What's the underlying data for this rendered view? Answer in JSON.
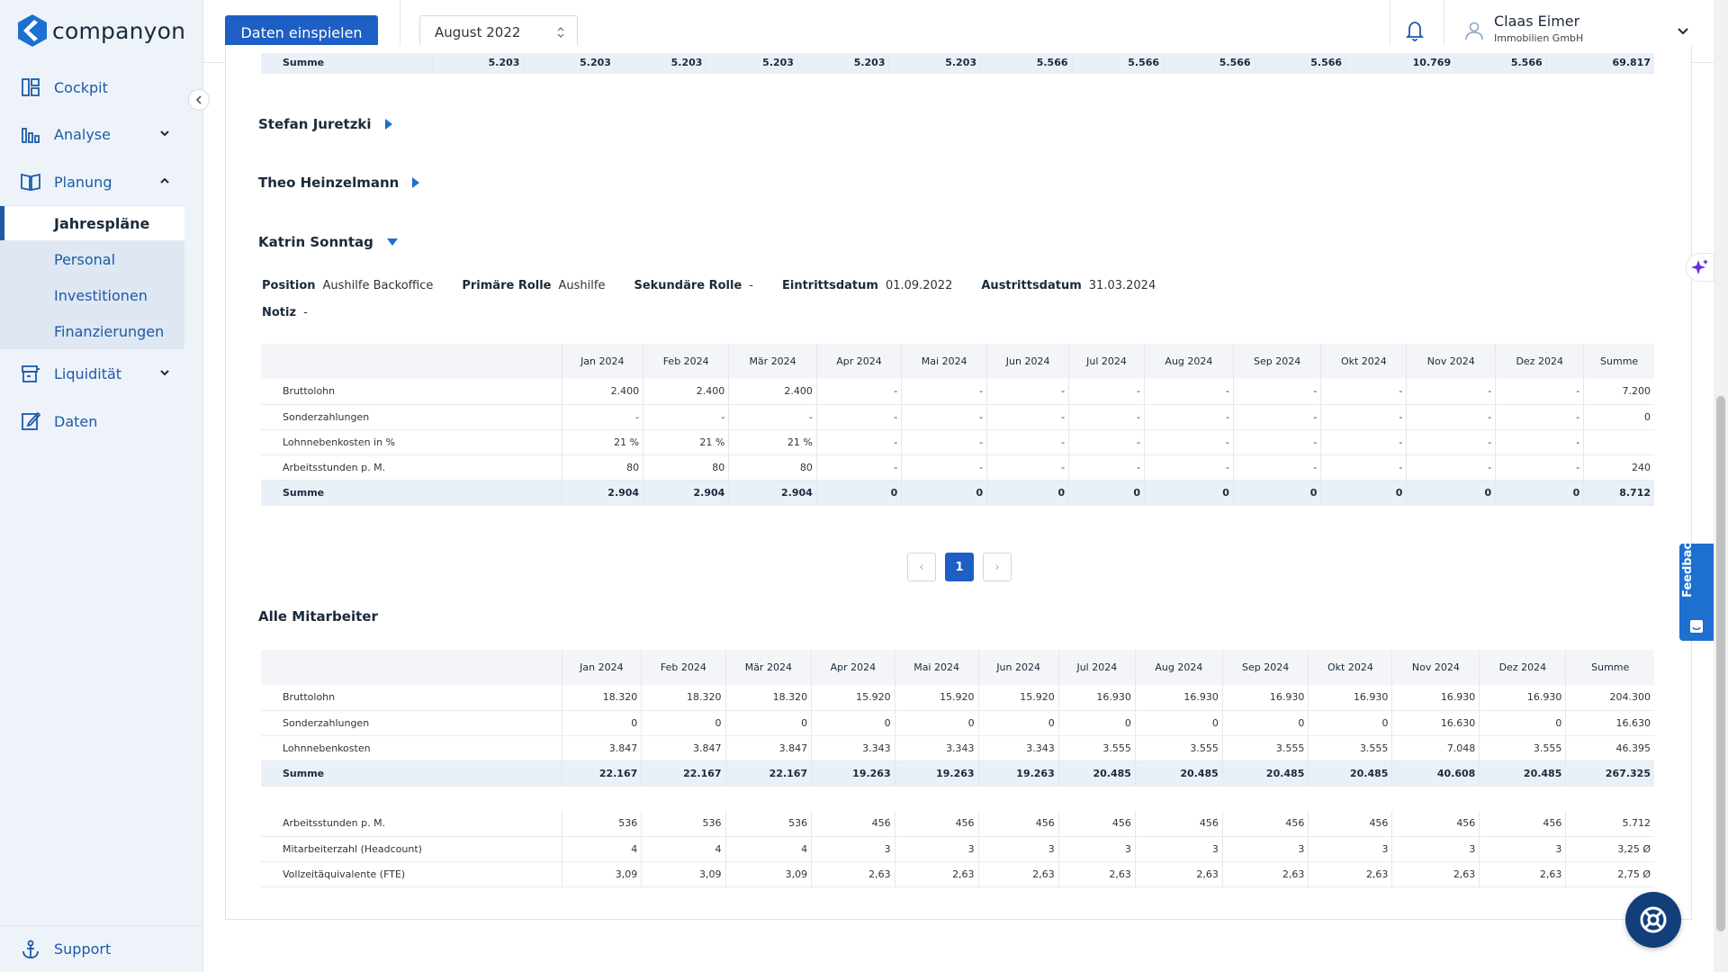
{
  "app": {
    "brand": "companyon"
  },
  "sidebar": {
    "items": [
      {
        "label": "Cockpit",
        "icon": "dashboard-icon"
      },
      {
        "label": "Analyse",
        "icon": "bar-chart-icon"
      },
      {
        "label": "Planung",
        "icon": "book-icon"
      },
      {
        "label": "Liquidität",
        "icon": "cash-register-icon"
      },
      {
        "label": "Daten",
        "icon": "edit-icon"
      }
    ],
    "planung_sub": [
      {
        "label": "Jahrespläne",
        "active": true
      },
      {
        "label": "Personal"
      },
      {
        "label": "Investitionen"
      },
      {
        "label": "Finanzierungen"
      }
    ],
    "support": "Support"
  },
  "topbar": {
    "primary_button": "Daten einspielen",
    "period": "August 2022",
    "user": {
      "name": "Claas Eimer",
      "company": "Immobilien GmbH"
    }
  },
  "colors": {
    "accent": "#1d5fc4",
    "sum_row": "#eaf0f8",
    "feedback": "#1d6fd0"
  },
  "prev_summary": {
    "label": "Summe",
    "values": [
      "5.203",
      "5.203",
      "5.203",
      "5.203",
      "5.203",
      "5.203",
      "5.566",
      "5.566",
      "5.566",
      "5.566",
      "10.769",
      "5.566",
      "69.817"
    ]
  },
  "employees": [
    {
      "name": "Stefan Juretzki",
      "expanded": false
    },
    {
      "name": "Theo Heinzelmann",
      "expanded": false
    },
    {
      "name": "Katrin Sonntag",
      "expanded": true
    }
  ],
  "katrin": {
    "info": {
      "position_label": "Position",
      "position": "Aushilfe Backoffice",
      "primary_label": "Primäre Rolle",
      "primary": "Aushilfe",
      "secondary_label": "Sekundäre Rolle",
      "secondary": "-",
      "entry_label": "Eintrittsdatum",
      "entry": "01.09.2022",
      "exit_label": "Austrittsdatum",
      "exit": "31.03.2024",
      "note_label": "Notiz",
      "note": "-"
    },
    "columns": [
      "",
      "Jan 2024",
      "Feb 2024",
      "Mär 2024",
      "Apr 2024",
      "Mai 2024",
      "Jun 2024",
      "Jul 2024",
      "Aug 2024",
      "Sep 2024",
      "Okt 2024",
      "Nov 2024",
      "Dez 2024",
      "Summe"
    ],
    "rows": [
      [
        "Bruttolohn",
        "2.400",
        "2.400",
        "2.400",
        "-",
        "-",
        "-",
        "-",
        "-",
        "-",
        "-",
        "-",
        "-",
        "7.200"
      ],
      [
        "Sonderzahlungen",
        "-",
        "-",
        "-",
        "-",
        "-",
        "-",
        "-",
        "-",
        "-",
        "-",
        "-",
        "-",
        "0"
      ],
      [
        "Lohnnebenkosten in %",
        "21 %",
        "21 %",
        "21 %",
        "-",
        "-",
        "-",
        "-",
        "-",
        "-",
        "-",
        "-",
        "-",
        ""
      ],
      [
        "Arbeitsstunden p. M.",
        "80",
        "80",
        "80",
        "-",
        "-",
        "-",
        "-",
        "-",
        "-",
        "-",
        "-",
        "-",
        "240"
      ]
    ],
    "sum_row": [
      "Summe",
      "2.904",
      "2.904",
      "2.904",
      "0",
      "0",
      "0",
      "0",
      "0",
      "0",
      "0",
      "0",
      "0",
      "8.712"
    ]
  },
  "pagination": {
    "current": "1",
    "prev": "‹",
    "next": "›"
  },
  "all_employees": {
    "title": "Alle Mitarbeiter",
    "columns": [
      "",
      "Jan 2024",
      "Feb 2024",
      "Mär 2024",
      "Apr 2024",
      "Mai 2024",
      "Jun 2024",
      "Jul 2024",
      "Aug 2024",
      "Sep 2024",
      "Okt 2024",
      "Nov 2024",
      "Dez 2024",
      "Summe"
    ],
    "rows": [
      [
        "Bruttolohn",
        "18.320",
        "18.320",
        "18.320",
        "15.920",
        "15.920",
        "15.920",
        "16.930",
        "16.930",
        "16.930",
        "16.930",
        "16.930",
        "16.930",
        "204.300"
      ],
      [
        "Sonderzahlungen",
        "0",
        "0",
        "0",
        "0",
        "0",
        "0",
        "0",
        "0",
        "0",
        "0",
        "16.630",
        "0",
        "16.630"
      ],
      [
        "Lohnnebenkosten",
        "3.847",
        "3.847",
        "3.847",
        "3.343",
        "3.343",
        "3.343",
        "3.555",
        "3.555",
        "3.555",
        "3.555",
        "7.048",
        "3.555",
        "46.395"
      ]
    ],
    "sum_row": [
      "Summe",
      "22.167",
      "22.167",
      "22.167",
      "19.263",
      "19.263",
      "19.263",
      "20.485",
      "20.485",
      "20.485",
      "20.485",
      "40.608",
      "20.485",
      "267.325"
    ],
    "extra_rows": [
      [
        "Arbeitsstunden p. M.",
        "536",
        "536",
        "536",
        "456",
        "456",
        "456",
        "456",
        "456",
        "456",
        "456",
        "456",
        "456",
        "5.712"
      ],
      [
        "Mitarbeiterzahl (Headcount)",
        "4",
        "4",
        "4",
        "3",
        "3",
        "3",
        "3",
        "3",
        "3",
        "3",
        "3",
        "3",
        "3,25 Ø"
      ],
      [
        "Vollzeitäquivalente (FTE)",
        "3,09",
        "3,09",
        "3,09",
        "2,63",
        "2,63",
        "2,63",
        "2,63",
        "2,63",
        "2,63",
        "2,63",
        "2,63",
        "2,63",
        "2,75 Ø"
      ]
    ]
  },
  "widgets": {
    "feedback": "Feedback"
  }
}
